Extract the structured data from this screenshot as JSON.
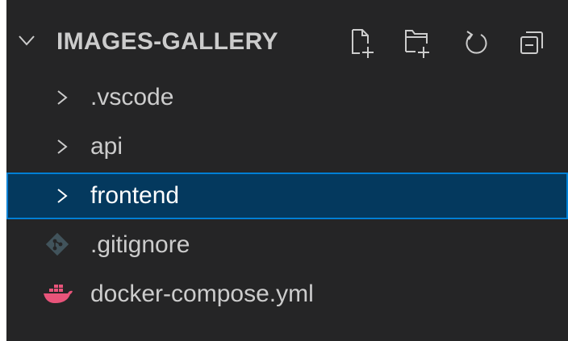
{
  "explorer": {
    "section_title": "IMAGES-GALLERY",
    "actions": [
      {
        "name": "new-file-icon"
      },
      {
        "name": "new-folder-icon"
      },
      {
        "name": "refresh-icon"
      },
      {
        "name": "collapse-all-icon"
      }
    ],
    "items": [
      {
        "label": ".vscode",
        "type": "folder"
      },
      {
        "label": "api",
        "type": "folder"
      },
      {
        "label": "frontend",
        "type": "folder",
        "selected": true
      },
      {
        "label": ".gitignore",
        "type": "file",
        "icon": "git-icon"
      },
      {
        "label": "docker-compose.yml",
        "type": "file",
        "icon": "docker-icon"
      }
    ]
  },
  "colors": {
    "background": "#252526",
    "text": "#cccccc",
    "selection_bg": "#04395e",
    "selection_border": "#007fd4",
    "docker": "#e8547a",
    "git": "#41535b"
  }
}
